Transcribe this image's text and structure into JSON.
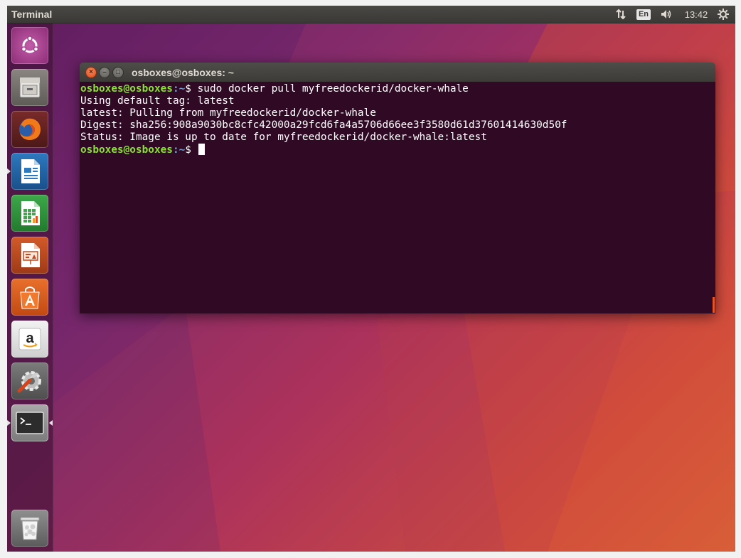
{
  "top_panel": {
    "app_title": "Terminal",
    "lang_indicator": "En",
    "clock": "13:42"
  },
  "launcher": {
    "items": [
      {
        "name": "ubuntu-dash",
        "icon": "ubuntu-logo-icon"
      },
      {
        "name": "files",
        "icon": "file-cabinet-icon"
      },
      {
        "name": "firefox",
        "icon": "firefox-icon"
      },
      {
        "name": "libreoffice-writer",
        "icon": "writer-document-icon"
      },
      {
        "name": "libreoffice-calc",
        "icon": "calc-spreadsheet-icon"
      },
      {
        "name": "libreoffice-impress",
        "icon": "impress-presentation-icon"
      },
      {
        "name": "ubuntu-software",
        "icon": "shopping-bag-icon"
      },
      {
        "name": "amazon",
        "icon": "amazon-icon"
      },
      {
        "name": "system-settings",
        "icon": "wrench-gear-icon"
      },
      {
        "name": "terminal",
        "icon": "terminal-icon"
      },
      {
        "name": "trash",
        "icon": "trash-icon"
      }
    ]
  },
  "terminal": {
    "window_title": "osboxes@osboxes: ~",
    "prompt_user": "osboxes@osboxes",
    "prompt_path": ":~",
    "prompt_symbol": "$",
    "command": " sudo docker pull myfreedockerid/docker-whale",
    "output": [
      "Using default tag: latest",
      "latest: Pulling from myfreedockerid/docker-whale",
      "Digest: sha256:908a9030bc8cfc42000a29fcd6fa4a5706d66ee3f3580d61d37601414630d50f",
      "Status: Image is up to date for myfreedockerid/docker-whale:latest"
    ],
    "prompt2_user": "osboxes@osboxes",
    "prompt2_path": ":~",
    "prompt2_symbol": "$ "
  },
  "colors": {
    "terminal_bg": "#300a24",
    "prompt_green": "#8ae234",
    "prompt_blue": "#729fcf",
    "accent_orange": "#e95420"
  }
}
